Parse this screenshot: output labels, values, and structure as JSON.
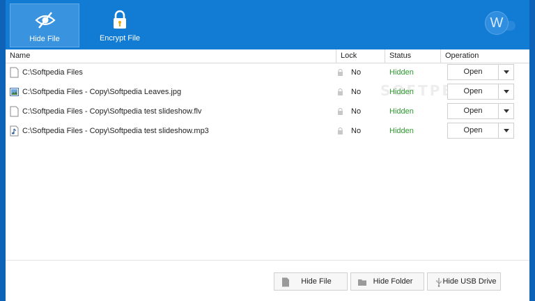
{
  "toolbar": {
    "tabs": [
      {
        "label": "Hide File",
        "icon": "eye-slash-icon",
        "active": true
      },
      {
        "label": "Encrypt File",
        "icon": "lock-key-icon",
        "active": false
      }
    ],
    "avatar_letter": "W"
  },
  "table": {
    "columns": {
      "name": "Name",
      "lock": "Lock",
      "status": "Status",
      "operation": "Operation"
    },
    "rows": [
      {
        "icon": "folder-file-icon",
        "name": "C:\\Softpedia Files",
        "lock": "No",
        "status": "Hidden",
        "operation": "Open"
      },
      {
        "icon": "image-file-icon",
        "name": "C:\\Softpedia Files - Copy\\Softpedia Leaves.jpg",
        "lock": "No",
        "status": "Hidden",
        "operation": "Open"
      },
      {
        "icon": "video-file-icon",
        "name": "C:\\Softpedia Files - Copy\\Softpedia test slideshow.flv",
        "lock": "No",
        "status": "Hidden",
        "operation": "Open"
      },
      {
        "icon": "audio-file-icon",
        "name": "C:\\Softpedia Files - Copy\\Softpedia test slideshow.mp3",
        "lock": "No",
        "status": "Hidden",
        "operation": "Open"
      }
    ]
  },
  "footer": {
    "hide_file": "Hide File",
    "hide_folder": "Hide Folder",
    "hide_usb": "Hide USB Drive"
  },
  "colors": {
    "accent": "#127bd4",
    "status_ok": "#2e9a2e"
  }
}
